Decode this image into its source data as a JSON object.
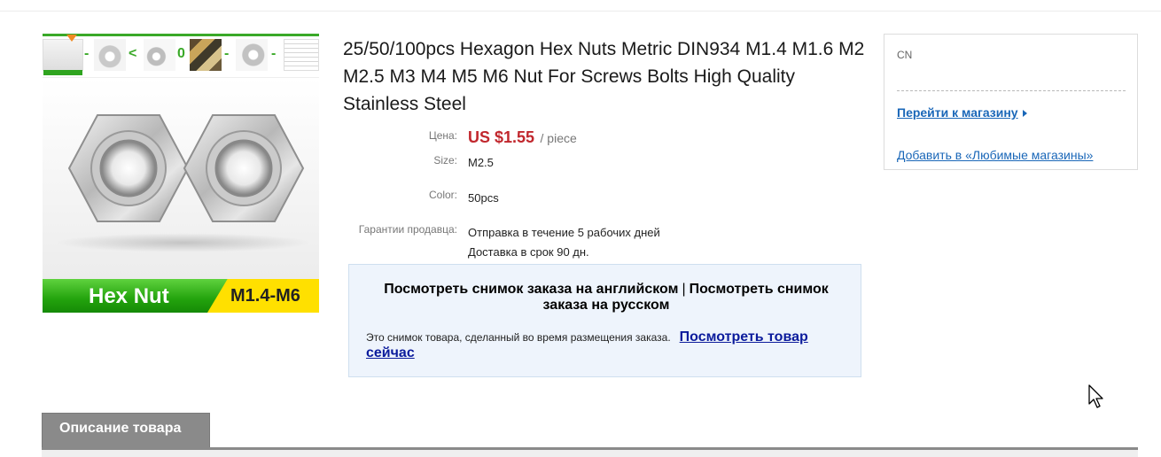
{
  "product": {
    "title": "25/50/100pcs Hexagon Hex Nuts Metric DIN934 M1.4 M1.6 M2 M2.5 M3 M4 M5 M6 Nut For Screws Bolts High Quality Stainless Steel",
    "image": {
      "banner_title": "Hex Nut",
      "banner_size": "M1.4-M6",
      "thumbnail_count": 7
    },
    "attributes": {
      "price_label": "Цена:",
      "price_value": "US $1.55",
      "price_unit": "/ piece",
      "size_label": "Size:",
      "size_value": "M2.5",
      "color_label": "Color:",
      "color_value": "50pcs",
      "guarantee_label": "Гарантии продавца:",
      "guarantee_line1": "Отправка в течение 5 рабочих дней",
      "guarantee_line2": "Доставка в срок 90 дн."
    }
  },
  "snapshot": {
    "link_english": "Посмотреть снимок заказа на английском",
    "separator": "|",
    "link_russian": "Посмотреть снимок заказа на русском",
    "note_text": "Это снимок товара, сделанный во время размещения заказа.",
    "note_link": "Посмотреть товар сейчас"
  },
  "store": {
    "country": "CN",
    "go_to_store": "Перейти к магазину",
    "add_favorite": "Добавить в «Любимые магазины»"
  },
  "tabs": {
    "description_label": "Описание товара"
  },
  "colors": {
    "price_red": "#c1272d",
    "link_blue": "#1a67b8",
    "snapshot_bg": "#eef4fc",
    "tab_gray": "#8a8a8a"
  }
}
